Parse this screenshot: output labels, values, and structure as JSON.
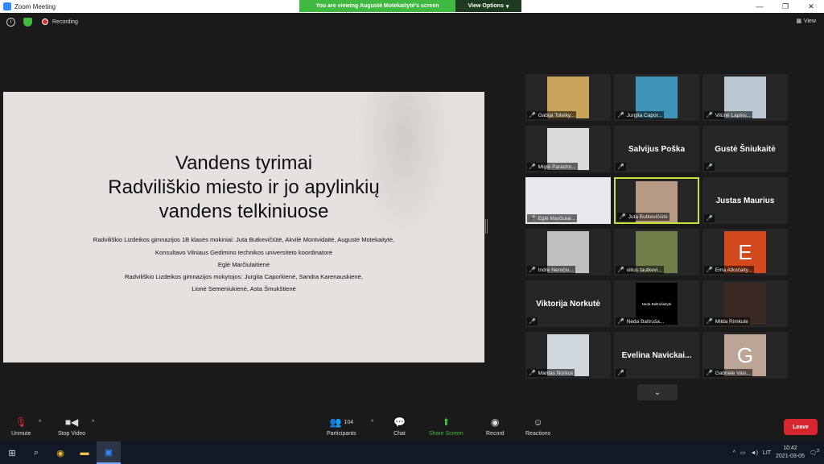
{
  "window": {
    "title": "Zoom Meeting",
    "controls": [
      "—",
      "❐",
      "✕"
    ]
  },
  "banner": {
    "message": "You are viewing Augustė Motekaitytė's screen",
    "view_options": "View Options"
  },
  "topbar": {
    "recording": "Recording",
    "view": "View"
  },
  "slide": {
    "title_lines": [
      "Vandens tyrimai",
      "Radviliškio miesto ir jo apylinkių",
      "vandens telkiniuose"
    ],
    "body_lines": [
      "Radviliškio Lizdeikos gimnazijos 1B klasės mokiniai: Juta Butkevičiūtė, Akvilė Montvidaitė,  Augustė Motekaitytė,",
      "Konsultavo Vilniaus Gedimino technikos universiteto koordinatorė",
      "Eglė Marčiulaitienė",
      "Radviliškio Lizdeikos gimnazijos mokytojos: Jurgita Caporkienė, Sandra Karenauskienė,",
      "Lionė Semeniukienė, Asta Šmukštienė"
    ]
  },
  "participants": [
    {
      "name": "Gabija Toleiky...",
      "kind": "video",
      "color": "#c9a35a"
    },
    {
      "name": "Jurgita Capor...",
      "kind": "video",
      "color": "#3d93b8"
    },
    {
      "name": "Vilūnė Lapins...",
      "kind": "video",
      "color": "#b9c7d1"
    },
    {
      "name": "Miglė Parachn...",
      "kind": "video",
      "color": "#d9d9d9"
    },
    {
      "name": "",
      "kind": "text",
      "label": "Salvijus Poška"
    },
    {
      "name": "",
      "kind": "text",
      "label": "Gustė Šniukaitė"
    },
    {
      "name": "Eglė Marčiulai...",
      "kind": "video",
      "color": "#e8e8ee"
    },
    {
      "name": "Juta Butkevičiūtė",
      "kind": "video",
      "color": "#b69a84",
      "active": true
    },
    {
      "name": "",
      "kind": "text",
      "label": "Justas Maurius"
    },
    {
      "name": "Indrė Nemčiu...",
      "kind": "video",
      "color": "#bfbfbf"
    },
    {
      "name": "vilius tautkevi...",
      "kind": "video",
      "color": "#6f7d49"
    },
    {
      "name": "Ema Atkočaity...",
      "kind": "avatar",
      "letter": "E",
      "color": "#d24a1c"
    },
    {
      "name": "",
      "kind": "text",
      "label": "Viktorija Norkutė"
    },
    {
      "name": "Neda Baltruša...",
      "kind": "video",
      "color": "#000000",
      "caption": "Neda Baltrušaitytė"
    },
    {
      "name": "Milda Rimkutė",
      "kind": "video",
      "color": "#3b2a24"
    },
    {
      "name": "Mantas Norkus",
      "kind": "video",
      "color": "#cfd6dc"
    },
    {
      "name": "",
      "kind": "text",
      "label": "Evelina  Navickai..."
    },
    {
      "name": "Gabriele Vais...",
      "kind": "avatar",
      "letter": "G",
      "color": "#bda596"
    }
  ],
  "toolbar": {
    "unmute": "Unmute",
    "stop_video": "Stop Video",
    "participants": "Participants",
    "participant_count": "104",
    "chat": "Chat",
    "share": "Share Screen",
    "record": "Record",
    "reactions": "Reactions",
    "leave": "Leave"
  },
  "taskbar": {
    "lang": "LIT",
    "time": "10:42",
    "date": "2021-03-05",
    "notifications": "3"
  }
}
